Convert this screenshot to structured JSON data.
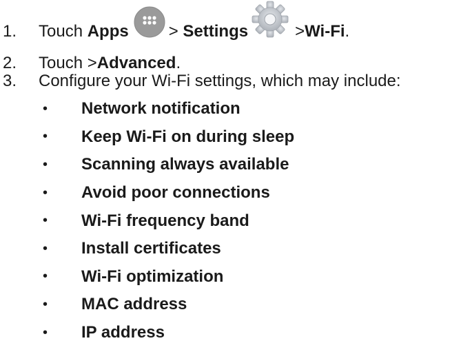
{
  "steps": [
    {
      "number": "1.",
      "touch": "Touch",
      "apps": "Apps",
      "sep1": ">",
      "settings": "Settings",
      "sep2": ">",
      "wifi": "Wi-Fi",
      "end": ".",
      "icons": [
        "apps-icon",
        "settings-gear-icon"
      ]
    },
    {
      "number": "2.",
      "touch": "Touch >",
      "advanced": "Advanced",
      "end": "."
    },
    {
      "number": "3.",
      "text": "Configure your Wi-Fi settings, which may include:"
    }
  ],
  "bullets": [
    "Network notification",
    "Keep Wi-Fi on during sleep",
    "Scanning always available",
    "Avoid poor connections",
    "Wi-Fi frequency band",
    "Install certificates",
    "Wi-Fi optimization",
    "MAC address",
    "IP address"
  ],
  "bullet_symbol": "•",
  "colors": {
    "text": "#1a1a1a",
    "apps_icon_bg": "#9a9a9a",
    "gear_icon": "#b8bcc2"
  }
}
